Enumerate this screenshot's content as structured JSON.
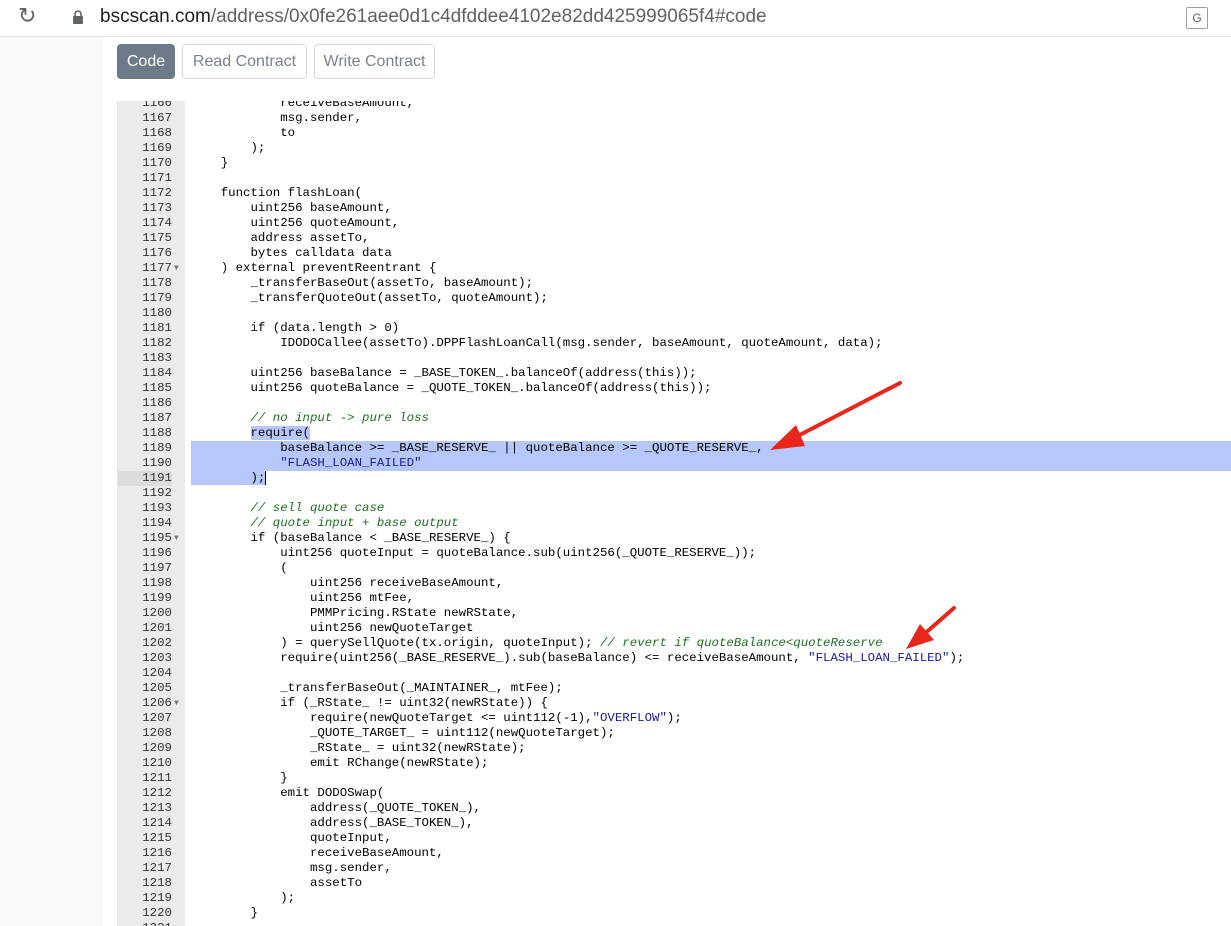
{
  "browser": {
    "url_host": "bscscan.com",
    "url_rest": "/address/0x0fe261aee0d1c4dfddee4102e82dd425999065f4#code"
  },
  "tabs": [
    {
      "label": "Code",
      "active": true
    },
    {
      "label": "Read Contract",
      "active": false
    },
    {
      "label": "Write Contract",
      "active": false
    }
  ],
  "editor": {
    "lines": [
      {
        "n": "1166",
        "code": "            receiveBaseAmount,"
      },
      {
        "n": "1167",
        "code": "            msg.sender,"
      },
      {
        "n": "1168",
        "code": "            to"
      },
      {
        "n": "1169",
        "code": "        );"
      },
      {
        "n": "1170",
        "code": "    }"
      },
      {
        "n": "1171",
        "code": ""
      },
      {
        "n": "1172",
        "code": "    function flashLoan("
      },
      {
        "n": "1173",
        "code": "        uint256 baseAmount,"
      },
      {
        "n": "1174",
        "code": "        uint256 quoteAmount,"
      },
      {
        "n": "1175",
        "code": "        address assetTo,"
      },
      {
        "n": "1176",
        "code": "        bytes calldata data"
      },
      {
        "n": "1177",
        "code": "    ) external preventReentrant {",
        "fold": true
      },
      {
        "n": "1178",
        "code": "        _transferBaseOut(assetTo, baseAmount);"
      },
      {
        "n": "1179",
        "code": "        _transferQuoteOut(assetTo, quoteAmount);"
      },
      {
        "n": "1180",
        "code": ""
      },
      {
        "n": "1181",
        "code": "        if (data.length > 0)"
      },
      {
        "n": "1182",
        "code": "            IDODOCallee(assetTo).DPPFlashLoanCall(msg.sender, baseAmount, quoteAmount, data);"
      },
      {
        "n": "1183",
        "code": ""
      },
      {
        "n": "1184",
        "code": "        uint256 baseBalance = _BASE_TOKEN_.balanceOf(address(this));"
      },
      {
        "n": "1185",
        "code": "        uint256 quoteBalance = _QUOTE_TOKEN_.balanceOf(address(this));"
      },
      {
        "n": "1186",
        "code": ""
      },
      {
        "n": "1187",
        "code": "        // no input -> pure loss",
        "type": "comment"
      },
      {
        "n": "1188",
        "code": "        require(",
        "hl": "partial",
        "hlstart": 8
      },
      {
        "n": "1189",
        "code": "            baseBalance >= _BASE_RESERVE_ || quoteBalance >= _QUOTE_RESERVE_,",
        "hl": "full"
      },
      {
        "n": "1190",
        "code": "            \"FLASH_LOAN_FAILED\"",
        "hl": "full",
        "type": "string"
      },
      {
        "n": "1191",
        "code": "        );",
        "hl": "partialend",
        "cur": true
      },
      {
        "n": "1192",
        "code": ""
      },
      {
        "n": "1193",
        "code": "        // sell quote case",
        "type": "comment"
      },
      {
        "n": "1194",
        "code": "        // quote input + base output",
        "type": "comment"
      },
      {
        "n": "1195",
        "code": "        if (baseBalance < _BASE_RESERVE_) {",
        "fold": true
      },
      {
        "n": "1196",
        "code": "            uint256 quoteInput = quoteBalance.sub(uint256(_QUOTE_RESERVE_));"
      },
      {
        "n": "1197",
        "code": "            ("
      },
      {
        "n": "1198",
        "code": "                uint256 receiveBaseAmount,"
      },
      {
        "n": "1199",
        "code": "                uint256 mtFee,"
      },
      {
        "n": "1200",
        "code": "                PMMPricing.RState newRState,"
      },
      {
        "n": "1201",
        "code": "                uint256 newQuoteTarget"
      },
      {
        "n": "1202",
        "code": "            ) = querySellQuote(tx.origin, quoteInput); ",
        "comment": "// revert if quoteBalance<quoteReserve"
      },
      {
        "n": "1203",
        "code": "            require(uint256(_BASE_RESERVE_).sub(baseBalance) <= receiveBaseAmount, ",
        "str": "\"FLASH_LOAN_FAILED\"",
        "tail": ");"
      },
      {
        "n": "1204",
        "code": ""
      },
      {
        "n": "1205",
        "code": "            _transferBaseOut(_MAINTAINER_, mtFee);"
      },
      {
        "n": "1206",
        "code": "            if (_RState_ != uint32(newRState)) {",
        "fold": true
      },
      {
        "n": "1207",
        "code": "                require(newQuoteTarget <= uint112(-1),",
        "str": "\"OVERFLOW\"",
        "tail": ");"
      },
      {
        "n": "1208",
        "code": "                _QUOTE_TARGET_ = uint112(newQuoteTarget);"
      },
      {
        "n": "1209",
        "code": "                _RState_ = uint32(newRState);"
      },
      {
        "n": "1210",
        "code": "                emit RChange(newRState);"
      },
      {
        "n": "1211",
        "code": "            }"
      },
      {
        "n": "1212",
        "code": "            emit DODOSwap("
      },
      {
        "n": "1213",
        "code": "                address(_QUOTE_TOKEN_),"
      },
      {
        "n": "1214",
        "code": "                address(_BASE_TOKEN_),"
      },
      {
        "n": "1215",
        "code": "                quoteInput,"
      },
      {
        "n": "1216",
        "code": "                receiveBaseAmount,"
      },
      {
        "n": "1217",
        "code": "                msg.sender,"
      },
      {
        "n": "1218",
        "code": "                assetTo"
      },
      {
        "n": "1219",
        "code": "            );"
      },
      {
        "n": "1220",
        "code": "        }"
      },
      {
        "n": "1221",
        "code": ""
      }
    ]
  },
  "colors": {
    "highlight": "#b5c7fb",
    "arrow": "#e8261b",
    "active_tab": "#6c7a89"
  }
}
